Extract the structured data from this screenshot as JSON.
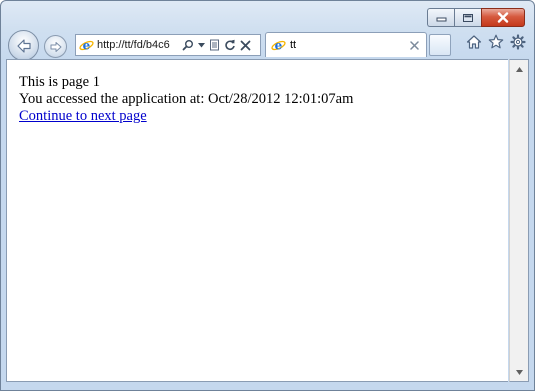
{
  "window": {
    "controls": {
      "minimize_icon": "minimize-icon",
      "maximize_icon": "maximize-icon",
      "close_icon": "close-icon"
    }
  },
  "toolbar": {
    "address_url": "http://tt/fd/b4c6",
    "tab_title": "tt",
    "icons": [
      "back-arrow-icon",
      "forward-arrow-icon",
      "ie-logo-icon",
      "search-icon",
      "dropdown-icon",
      "compatibility-view-icon",
      "refresh-icon",
      "stop-icon",
      "tab-close-icon",
      "home-icon",
      "favorites-star-icon",
      "tools-gear-icon"
    ]
  },
  "page": {
    "line1": "This is page 1",
    "line2": "You accessed the application at: Oct/28/2012 12:01:07am",
    "link_text": "Continue to next page"
  },
  "colors": {
    "link": "#0000cc",
    "close_button": "#c4391b",
    "frame": "#c5d8ee"
  }
}
